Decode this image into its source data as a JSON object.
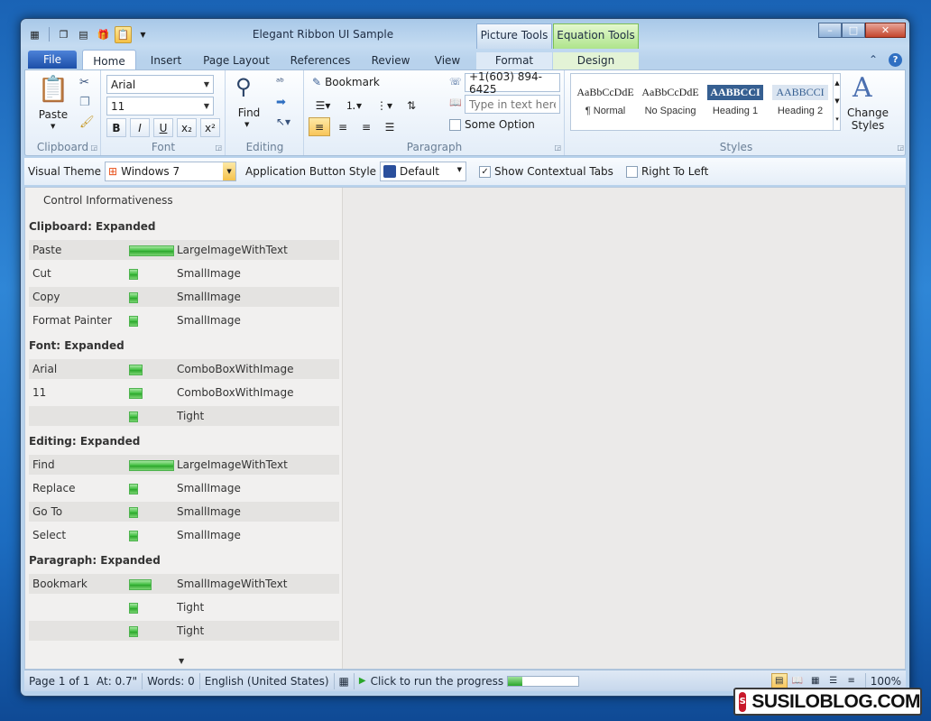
{
  "window": {
    "title": "Elegant Ribbon UI Sample",
    "contextual_tabs": [
      "Picture Tools",
      "Equation Tools"
    ],
    "controls": {
      "minimize": "–",
      "maximize": "□",
      "close": "✕"
    }
  },
  "tabs": {
    "file": "File",
    "items": [
      "Home",
      "Insert",
      "Page Layout",
      "References",
      "Review",
      "View",
      "Format",
      "Design"
    ],
    "active": "Home"
  },
  "ribbon": {
    "clipboard": {
      "label": "Clipboard",
      "paste": "Paste"
    },
    "font": {
      "label": "Font",
      "family": "Arial",
      "size": "11",
      "buttons": [
        "B",
        "I",
        "U",
        "x₂",
        "x²"
      ]
    },
    "editing": {
      "label": "Editing",
      "find": "Find"
    },
    "paragraph": {
      "label": "Paragraph",
      "bookmark": "Bookmark",
      "phone": "+1(603) 894-6425",
      "text_placeholder": "Type in text here",
      "option": "Some Option"
    },
    "styles": {
      "label": "Styles",
      "items": [
        {
          "preview": "AaBbCcDdE",
          "name": "¶ Normal"
        },
        {
          "preview": "AaBbCcDdE",
          "name": "No Spacing"
        },
        {
          "preview": "AABBCCI",
          "name": "Heading 1"
        },
        {
          "preview": "AABBCCI",
          "name": "Heading 2"
        }
      ],
      "change_styles": "Change Styles"
    }
  },
  "options": {
    "visual_theme_label": "Visual Theme",
    "visual_theme_value": "Windows 7",
    "app_button_label": "Application Button Style",
    "app_button_value": "Default",
    "show_contextual_tabs": "Show Contextual Tabs",
    "show_contextual_tabs_checked": true,
    "right_to_left": "Right To Left",
    "right_to_left_checked": false
  },
  "panel": {
    "title": "Control Informativeness",
    "sections": [
      {
        "header": "Clipboard: Expanded",
        "rows": [
          {
            "name": "Paste",
            "level": 1.0,
            "mode": "LargeImageWithText"
          },
          {
            "name": "Cut",
            "level": 0.2,
            "mode": "SmallImage"
          },
          {
            "name": "Copy",
            "level": 0.2,
            "mode": "SmallImage"
          },
          {
            "name": "Format Painter",
            "level": 0.2,
            "mode": "SmallImage"
          }
        ]
      },
      {
        "header": "Font: Expanded",
        "rows": [
          {
            "name": "Arial",
            "level": 0.3,
            "mode": "ComboBoxWithImage"
          },
          {
            "name": "11",
            "level": 0.3,
            "mode": "ComboBoxWithImage"
          },
          {
            "name": "",
            "level": 0.2,
            "mode": "Tight"
          }
        ]
      },
      {
        "header": "Editing: Expanded",
        "rows": [
          {
            "name": "Find",
            "level": 1.0,
            "mode": "LargeImageWithText"
          },
          {
            "name": "Replace",
            "level": 0.2,
            "mode": "SmallImage"
          },
          {
            "name": "Go To",
            "level": 0.2,
            "mode": "SmallImage"
          },
          {
            "name": "Select",
            "level": 0.2,
            "mode": "SmallImage"
          }
        ]
      },
      {
        "header": "Paragraph: Expanded",
        "rows": [
          {
            "name": "Bookmark",
            "level": 0.5,
            "mode": "SmallImageWithText"
          },
          {
            "name": "",
            "level": 0.2,
            "mode": "Tight"
          },
          {
            "name": "",
            "level": 0.2,
            "mode": "Tight"
          }
        ]
      }
    ]
  },
  "status": {
    "page": "Page 1 of 1",
    "at": "At: 0.7\"",
    "words": "Words: 0",
    "language": "English (United States)",
    "run_label": "Click to run the progress",
    "progress": 0.2,
    "zoom": "100%"
  },
  "watermark": "SUSILOBLOG.COM"
}
